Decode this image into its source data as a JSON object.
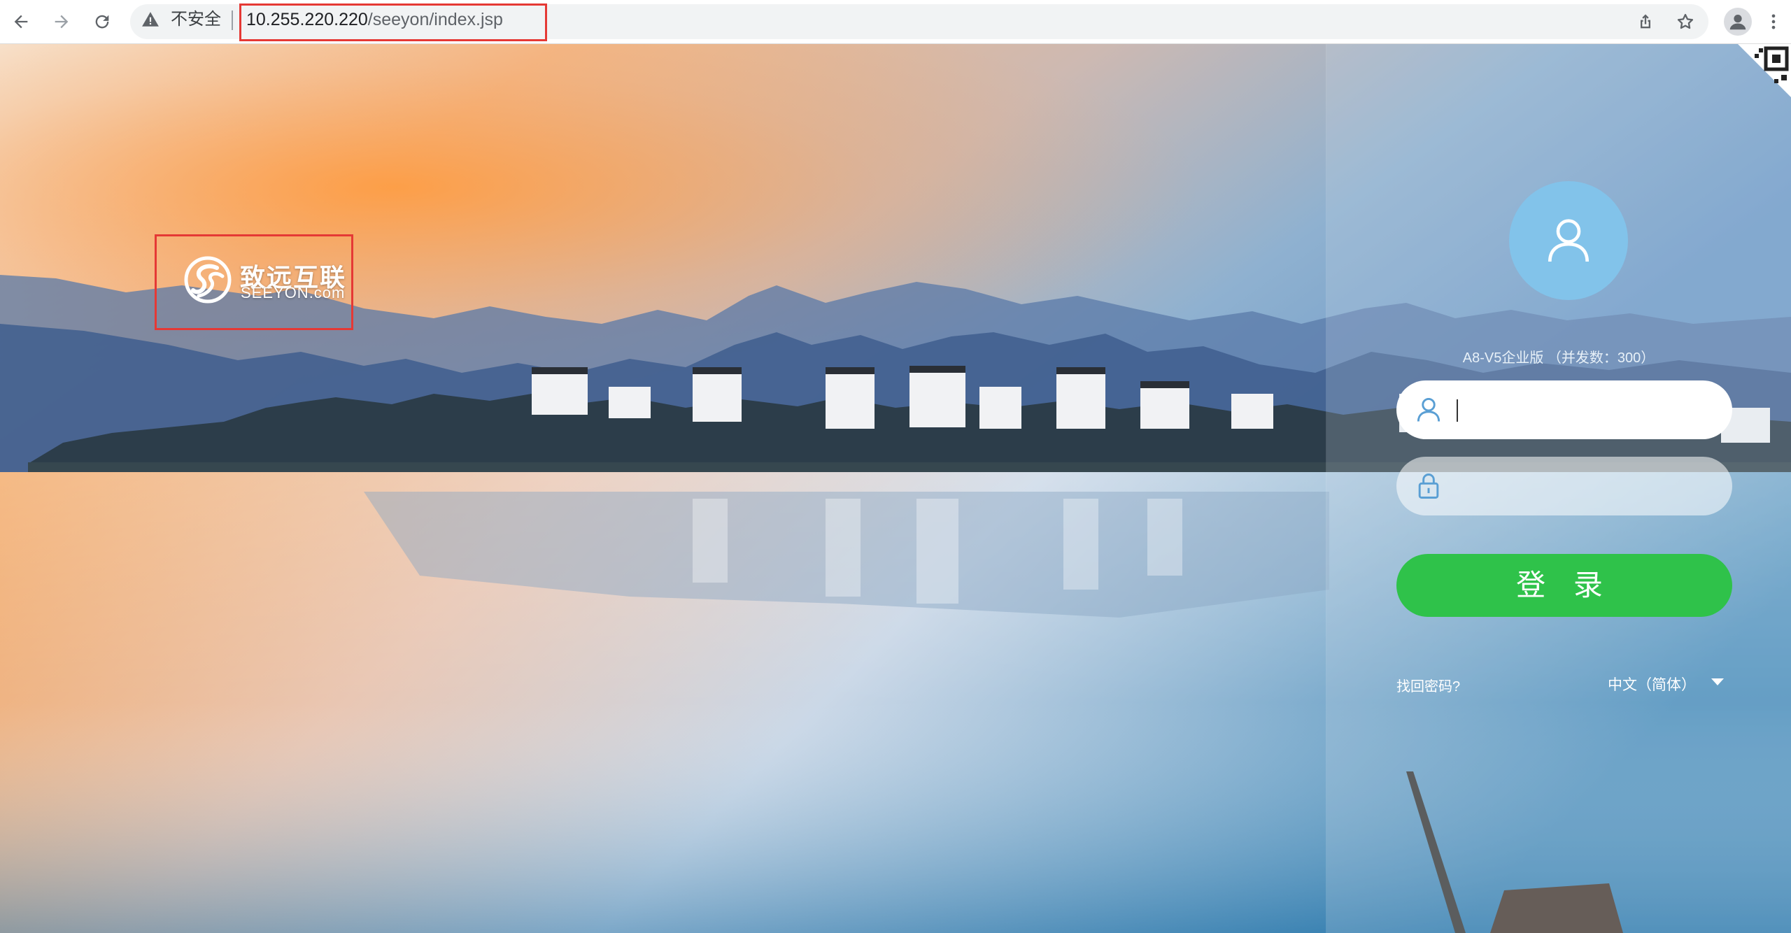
{
  "browser": {
    "security_label": "不安全",
    "url_host": "10.255.220.220",
    "url_path": "/seeyon/index.jsp",
    "icons": [
      "back-arrow-icon",
      "forward-arrow-icon",
      "reload-icon",
      "warning-icon",
      "share-icon",
      "star-icon",
      "profile-icon",
      "more-icon"
    ]
  },
  "brand": {
    "name_cn": "致远互联",
    "domain": "SEEYON.com"
  },
  "login": {
    "version": "A8-V5企业版 （并发数：300）",
    "username_value": "",
    "password_value": "",
    "login_button": "登 录",
    "forgot_password": "找回密码?",
    "language": "中文（简体）"
  },
  "colors": {
    "login_button": "#2fc24a",
    "avatar_circle": "#82c3ea",
    "highlight_box": "#e53935"
  }
}
